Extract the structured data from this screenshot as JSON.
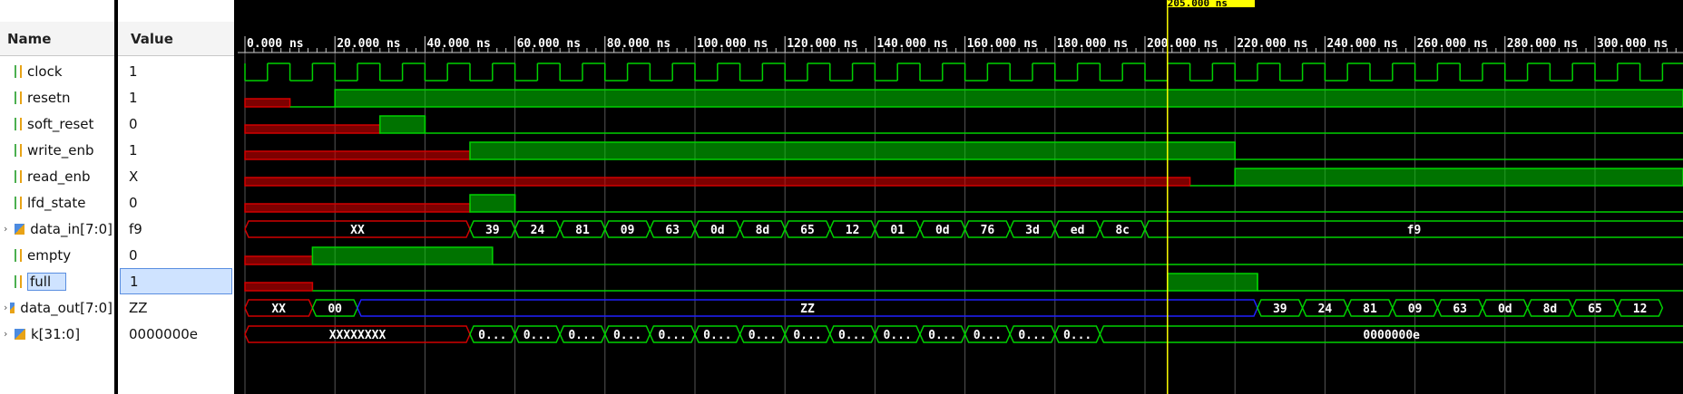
{
  "columns": {
    "name": "Name",
    "value": "Value"
  },
  "cursor": {
    "label": "205.000 ns"
  },
  "colors": {
    "wave_green": "#00d100",
    "wave_red": "#d10000",
    "bus_blue": "#2020ff",
    "cursor": "#ffff00",
    "grid": "#555555"
  },
  "timeline": {
    "ticks": [
      "0.000 ns",
      "20.000 ns",
      "40.000 ns",
      "60.000 ns",
      "80.000 ns",
      "100.000 ns",
      "120.000 ns",
      "140.000 ns",
      "160.000 ns",
      "180.000 ns",
      "200.000 ns",
      "220.000 ns",
      "240.000 ns",
      "260.000 ns",
      "280.000 ns",
      "300.000 ns"
    ]
  },
  "signals": [
    {
      "name": "clock",
      "value": "1",
      "type": "bit",
      "icon": "signal-icon"
    },
    {
      "name": "resetn",
      "value": "1",
      "type": "bit",
      "icon": "signal-icon"
    },
    {
      "name": "soft_reset",
      "value": "0",
      "type": "bit",
      "icon": "signal-icon"
    },
    {
      "name": "write_enb",
      "value": "1",
      "type": "bit",
      "icon": "signal-icon"
    },
    {
      "name": "read_enb",
      "value": "X",
      "type": "bit",
      "icon": "signal-icon"
    },
    {
      "name": "lfd_state",
      "value": "0",
      "type": "bit",
      "icon": "signal-icon"
    },
    {
      "name": "data_in[7:0]",
      "value": "f9",
      "type": "bus",
      "icon": "bus-icon",
      "expandable": true,
      "segments": [
        "XX",
        "39",
        "24",
        "81",
        "09",
        "63",
        "0d",
        "8d",
        "65",
        "12",
        "01",
        "0d",
        "76",
        "3d",
        "ed",
        "8c",
        "f9"
      ]
    },
    {
      "name": "empty",
      "value": "0",
      "type": "bit",
      "icon": "signal-icon"
    },
    {
      "name": "full",
      "value": "1",
      "type": "bit",
      "icon": "signal-icon",
      "selected": true
    },
    {
      "name": "data_out[7:0]",
      "value": "ZZ",
      "type": "bus",
      "icon": "bus-icon",
      "expandable": true,
      "segments": [
        "XX",
        "00",
        "ZZ",
        "39",
        "24",
        "81",
        "09",
        "63",
        "0d",
        "8d",
        "65",
        "12"
      ]
    },
    {
      "name": "k[31:0]",
      "value": "0000000e",
      "type": "bus",
      "icon": "bus-icon",
      "expandable": true,
      "segments": [
        "XXXXXXXX",
        "0...",
        "0...",
        "0...",
        "0...",
        "0...",
        "0...",
        "0...",
        "0...",
        "0...",
        "0...",
        "0...",
        "0...",
        "0...",
        "0...",
        "0000000e"
      ]
    }
  ]
}
